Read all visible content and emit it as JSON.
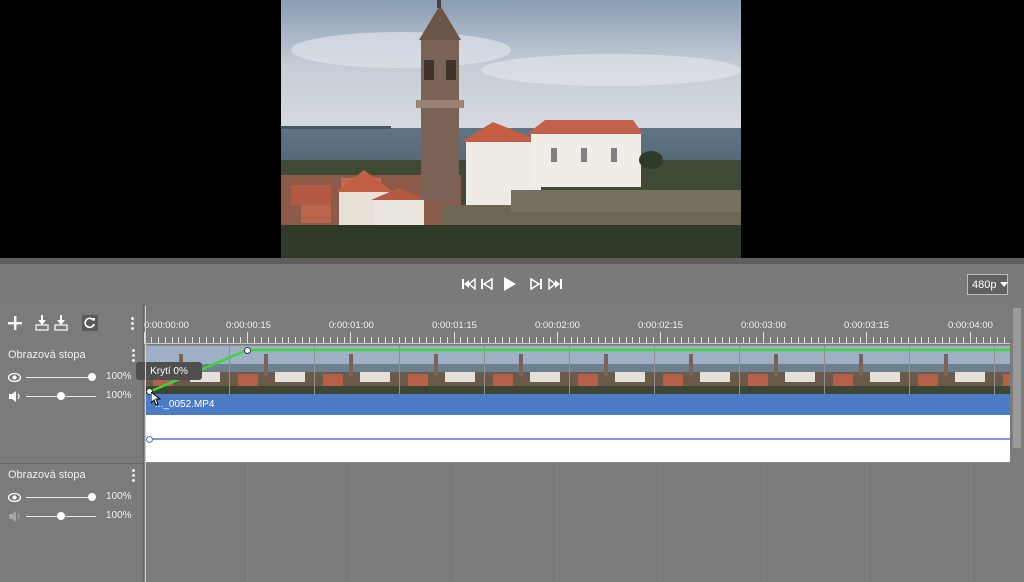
{
  "transport": {
    "buttons": [
      "rewind-start",
      "prev-frame",
      "play",
      "next-frame",
      "fast-forward-end"
    ],
    "quality": "480p"
  },
  "toolbar": {
    "add_icon": "plus-icon",
    "split_icons": [
      "align-bottom-icon",
      "align-bottom-icon"
    ],
    "refresh_icon": "refresh-icon"
  },
  "ruler": {
    "labels": [
      "0:00:00:00",
      "0:00:00:15",
      "0:00:01:00",
      "0:00:01:15",
      "0:00:02:00",
      "0:00:02:15",
      "0:00:03:00",
      "0:00:03:15",
      "0:00:04:00"
    ]
  },
  "tracks": [
    {
      "name": "Obrazová stopa",
      "opacity": "100%",
      "volume": "100%",
      "opacity_level": 1.0,
      "volume_level": 0.5,
      "clip": {
        "name": "..._0052.MP4",
        "keyframe_tooltip": "Krytí 0%"
      }
    },
    {
      "name": "Obrazová stopa",
      "opacity": "100%",
      "volume": "100%",
      "opacity_level": 1.0,
      "volume_level": 0.5
    }
  ],
  "colors": {
    "accent": "#4d7cc6",
    "keyframe_line": "#3ad63a",
    "background": "#7b7b7b"
  }
}
